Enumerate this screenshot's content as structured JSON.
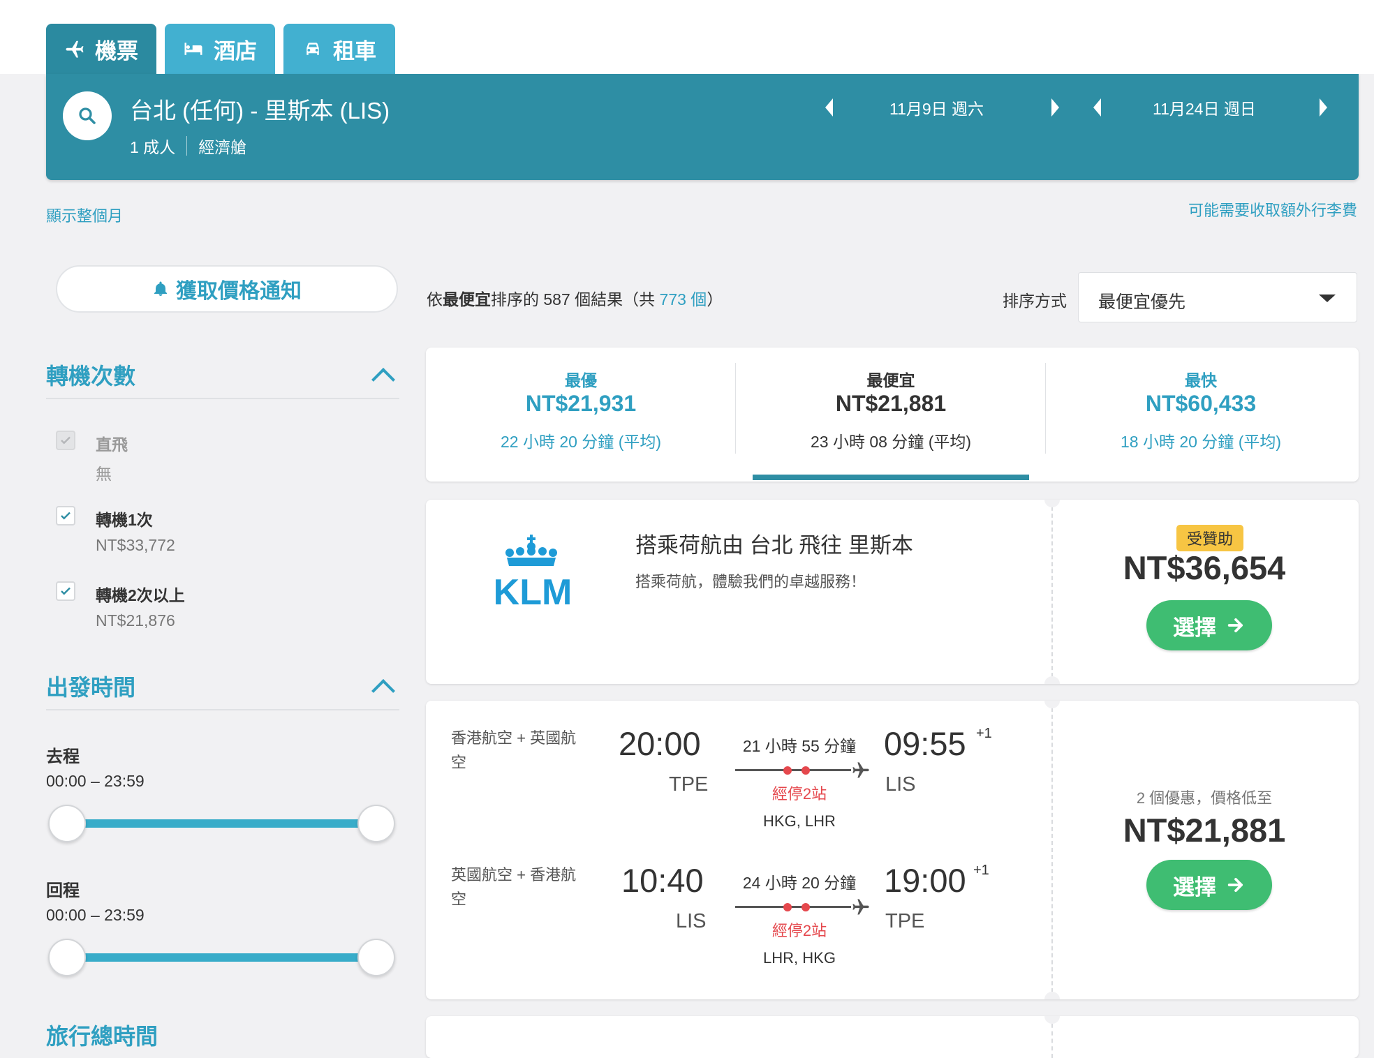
{
  "tabs": {
    "flights": "機票",
    "hotels": "酒店",
    "cars": "租車"
  },
  "search": {
    "route": "台北 (任何) - 里斯本 (LIS)",
    "passengers": "1 成人",
    "cabin": "經濟艙",
    "depart_date": "11月9日 週六",
    "return_date": "11月24日 週日"
  },
  "links": {
    "show_month": "顯示整個月",
    "baggage_fee": "可能需要收取額外行李費"
  },
  "price_alert": "獲取價格通知",
  "filters": {
    "stops": {
      "title": "轉機次數",
      "options": [
        {
          "label": "直飛",
          "price": "無",
          "checked": true,
          "disabled": true
        },
        {
          "label": "轉機1次",
          "price": "NT$33,772",
          "checked": true,
          "disabled": false
        },
        {
          "label": "轉機2次以上",
          "price": "NT$21,876",
          "checked": true,
          "disabled": false
        }
      ]
    },
    "times": {
      "title": "出發時間",
      "outbound_label": "去程",
      "outbound_range": "00:00 – 23:59",
      "inbound_label": "回程",
      "inbound_range": "00:00 – 23:59"
    },
    "next_section_partial": "旅行總時間"
  },
  "results": {
    "prefix": "依",
    "sort_word": "最便宜",
    "middle": "排序的 587 個結果（共 ",
    "total": "773 個",
    "suffix": "）",
    "sort_label": "排序方式",
    "sort_value": "最便宜優先"
  },
  "summary": [
    {
      "label": "最優",
      "price": "NT$21,931",
      "duration": "22 小時 20 分鐘 (平均)",
      "style": "blue"
    },
    {
      "label": "最便宜",
      "price": "NT$21,881",
      "duration": "23 小時 08 分鐘 (平均)",
      "style": "dark",
      "selected": true
    },
    {
      "label": "最快",
      "price": "NT$60,433",
      "duration": "18 小時 20 分鐘 (平均)",
      "style": "blue"
    }
  ],
  "ad": {
    "logo_text": "KLM",
    "title": "搭乘荷航由 台北 飛往 里斯本",
    "subtitle": "搭乘荷航，體驗我們的卓越服務！",
    "badge": "受贊助",
    "price": "NT$36,654",
    "button": "選擇"
  },
  "flight_result": {
    "legs": [
      {
        "airline": "香港航空 + 英國航空",
        "dep_time": "20:00",
        "dep_airport": "TPE",
        "duration": "21 小時 55 分鐘",
        "stops": "經停2站",
        "via": "HKG, LHR",
        "arr_time": "09:55",
        "arr_airport": "LIS",
        "day_offset": "+1"
      },
      {
        "airline": "英國航空 + 香港航空",
        "dep_time": "10:40",
        "dep_airport": "LIS",
        "duration": "24 小時 20 分鐘",
        "stops": "經停2站",
        "via": "LHR, HKG",
        "arr_time": "19:00",
        "arr_airport": "TPE",
        "day_offset": "+1"
      }
    ],
    "deal_text": "2 個優惠，價格低至",
    "price": "NT$21,881",
    "button": "選擇"
  },
  "colors": {
    "primary": "#2e8ea4",
    "tab_light": "#42b0d0",
    "link": "#2f9fc1",
    "select_green": "#3fbd72",
    "badge_yellow": "#f7c543",
    "stop_red": "#e5484d",
    "klm_blue": "#1e9bd7"
  },
  "icons": {
    "flights": "plane-icon",
    "hotels": "bed-icon",
    "cars": "car-icon",
    "search": "search-icon",
    "alert": "bell-icon"
  }
}
